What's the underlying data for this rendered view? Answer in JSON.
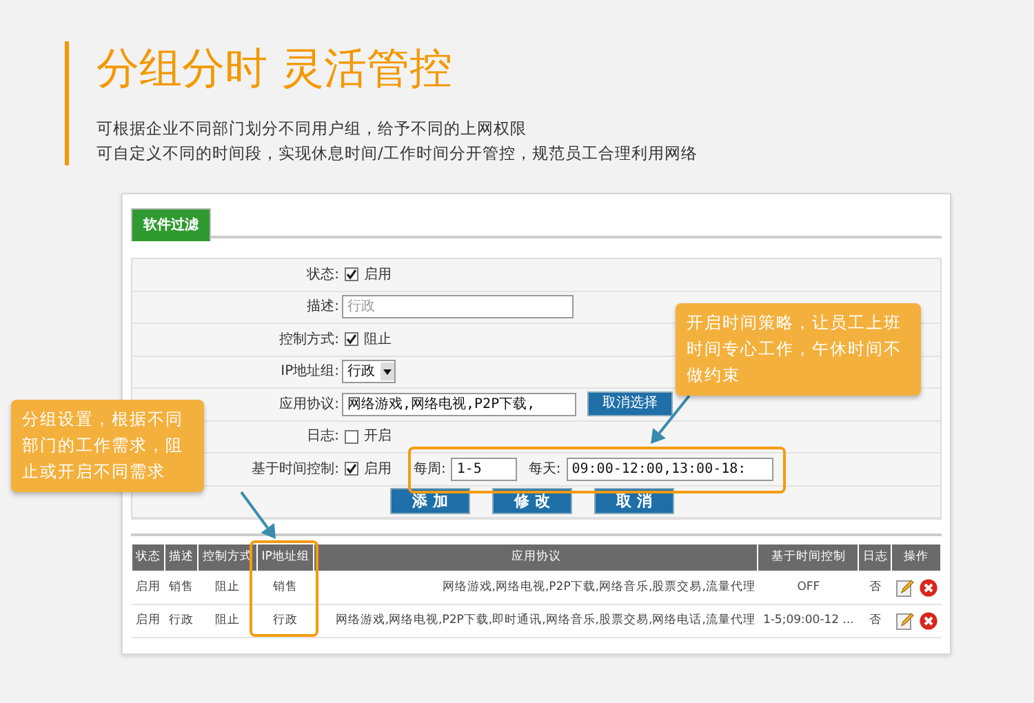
{
  "header": {
    "title": "分组分时 灵活管控",
    "lines": [
      "可根据企业不同部门划分不同用户组，给予不同的上网权限",
      "可自定义不同的时间段，实现休息时间/工作时间分开管控，规范员工合理利用网络"
    ]
  },
  "panel": {
    "tabs": [
      {
        "label": "软件过滤",
        "selected": true
      }
    ],
    "form": [
      {
        "kind": "checkbox",
        "label": "状态:",
        "checked": true,
        "text": "启用"
      },
      {
        "kind": "text",
        "label": "描述:",
        "placeholder": "行政"
      },
      {
        "kind": "checkbox",
        "label": "控制方式:",
        "checked": true,
        "text": "阻止"
      },
      {
        "kind": "select",
        "label": "IP地址组:",
        "value": "行政"
      },
      {
        "kind": "apps",
        "label": "应用协议:",
        "value": "网络游戏,网络电视,P2P下载,",
        "button": "取消选择"
      },
      {
        "kind": "checkbox",
        "label": "日志:",
        "checked": false,
        "text": "开启"
      },
      {
        "kind": "time",
        "label": "基于时间控制:",
        "checked": true,
        "text": "启用",
        "week_label": "每周:",
        "week": "1-5",
        "day_label": "每天:",
        "day": "09:00-12:00,13:00-18:"
      }
    ],
    "actions": [
      "添 加",
      "修 改",
      "取 消"
    ],
    "table": {
      "columns": [
        "状态",
        "描述",
        "控制方式",
        "IP地址组",
        "应用协议",
        "基于时间控制",
        "日志",
        "操作"
      ],
      "rows": [
        {
          "cells": [
            "启用",
            "销售",
            "阻止",
            "销售",
            "网络游戏,网络电视,P2P下载,网络音乐,股票交易,流量代理",
            "OFF",
            "否"
          ]
        },
        {
          "cells": [
            "启用",
            "行政",
            "阻止",
            "行政",
            "网络游戏,网络电视,P2P下载,即时通讯,网络音乐,股票交易,网络电话,流量代理",
            "1-5;09:00-12 ...",
            "否"
          ]
        }
      ]
    }
  },
  "callouts": [
    {
      "text": "分组设置，根据不同部门的工作需求，阻止或开启不同需求"
    },
    {
      "text": "开启时间策略，让员工上班时间专心工作，午休时间不做约束"
    }
  ]
}
